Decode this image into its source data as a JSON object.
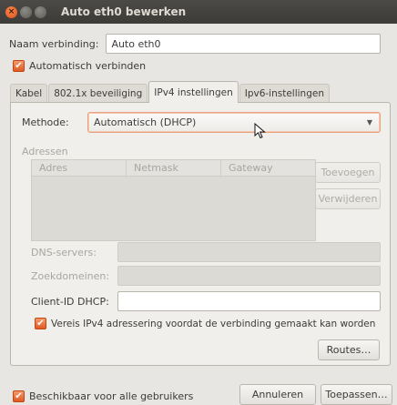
{
  "window": {
    "title": "Auto eth0 bewerken"
  },
  "connection": {
    "name_label": "Naam verbinding:",
    "name_value": "Auto eth0",
    "autoconnect_label": "Automatisch verbinden"
  },
  "tabs": [
    {
      "label": "Kabel"
    },
    {
      "label": "802.1x beveiliging"
    },
    {
      "label": "IPv4 instellingen"
    },
    {
      "label": "Ipv6-instellingen"
    }
  ],
  "ipv4": {
    "method_label": "Methode:",
    "method_value": "Automatisch (DHCP)",
    "addresses_label": "Adressen",
    "columns": [
      "Adres",
      "Netmask",
      "Gateway"
    ],
    "add_button": "Toevoegen",
    "remove_button": "Verwijderen",
    "dns_label": "DNS-servers:",
    "search_domains_label": "Zoekdomeinen:",
    "client_id_label": "Client-ID DHCP:",
    "require_ipv4_label": "Vereis IPv4 adressering voordat de verbinding gemaakt kan worden",
    "routes_button": "Routes…"
  },
  "footer": {
    "all_users_label": "Beschikbaar voor alle gebruikers",
    "cancel_button": "Annuleren",
    "apply_button": "Toepassen…"
  },
  "colors": {
    "accent": "#e05a25",
    "titlebar": "#3c3b37"
  }
}
